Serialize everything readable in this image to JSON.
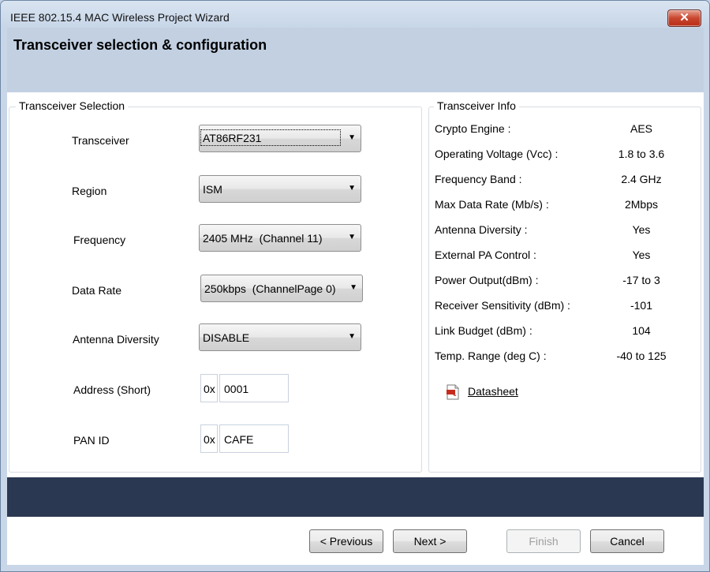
{
  "window": {
    "title": "IEEE 802.15.4 MAC Wireless Project Wizard",
    "close_glyph": "✕"
  },
  "header": {
    "title": "Transceiver selection & configuration"
  },
  "selection": {
    "group_title": "Transceiver Selection",
    "transceiver": {
      "label": "Transceiver",
      "value": "AT86RF231"
    },
    "region": {
      "label": "Region",
      "value": "ISM"
    },
    "frequency": {
      "label": "Frequency",
      "value": "2405 MHz  (Channel 11)"
    },
    "data_rate": {
      "label": "Data Rate",
      "value": "250kbps  (ChannelPage 0)"
    },
    "antenna_diversity": {
      "label": "Antenna Diversity",
      "value": "DISABLE"
    },
    "address_short": {
      "label": "Address (Short)",
      "prefix": "0x",
      "value": "0001"
    },
    "pan_id": {
      "label": "PAN ID",
      "prefix": "0x",
      "value": "CAFE"
    }
  },
  "info": {
    "group_title": "Transceiver Info",
    "rows": [
      {
        "label": "Crypto Engine :",
        "value": "AES"
      },
      {
        "label": "Operating Voltage (Vcc) :",
        "value": "1.8 to 3.6"
      },
      {
        "label": "Frequency Band :",
        "value": "2.4 GHz"
      },
      {
        "label": "Max Data Rate (Mb/s) :",
        "value": "2Mbps"
      },
      {
        "label": "Antenna Diversity :",
        "value": "Yes"
      },
      {
        "label": "External PA Control :",
        "value": "Yes"
      },
      {
        "label": "Power Output(dBm) :",
        "value": "-17 to 3"
      },
      {
        "label": "Receiver Sensitivity (dBm) :",
        "value": "-101"
      },
      {
        "label": "Link Budget (dBm) :",
        "value": "104"
      },
      {
        "label": "Temp. Range (deg C) :",
        "value": "-40 to 125"
      }
    ],
    "datasheet_link": "Datasheet",
    "datasheet_icon": "pdf-icon"
  },
  "buttons": {
    "previous": "< Previous",
    "next": "Next >",
    "finish": "Finish",
    "cancel": "Cancel"
  },
  "dropdown_arrow": "▼",
  "colors": {
    "banner": "#2a3852",
    "header": "#c2d0e2",
    "close_button": "#c9462f"
  }
}
